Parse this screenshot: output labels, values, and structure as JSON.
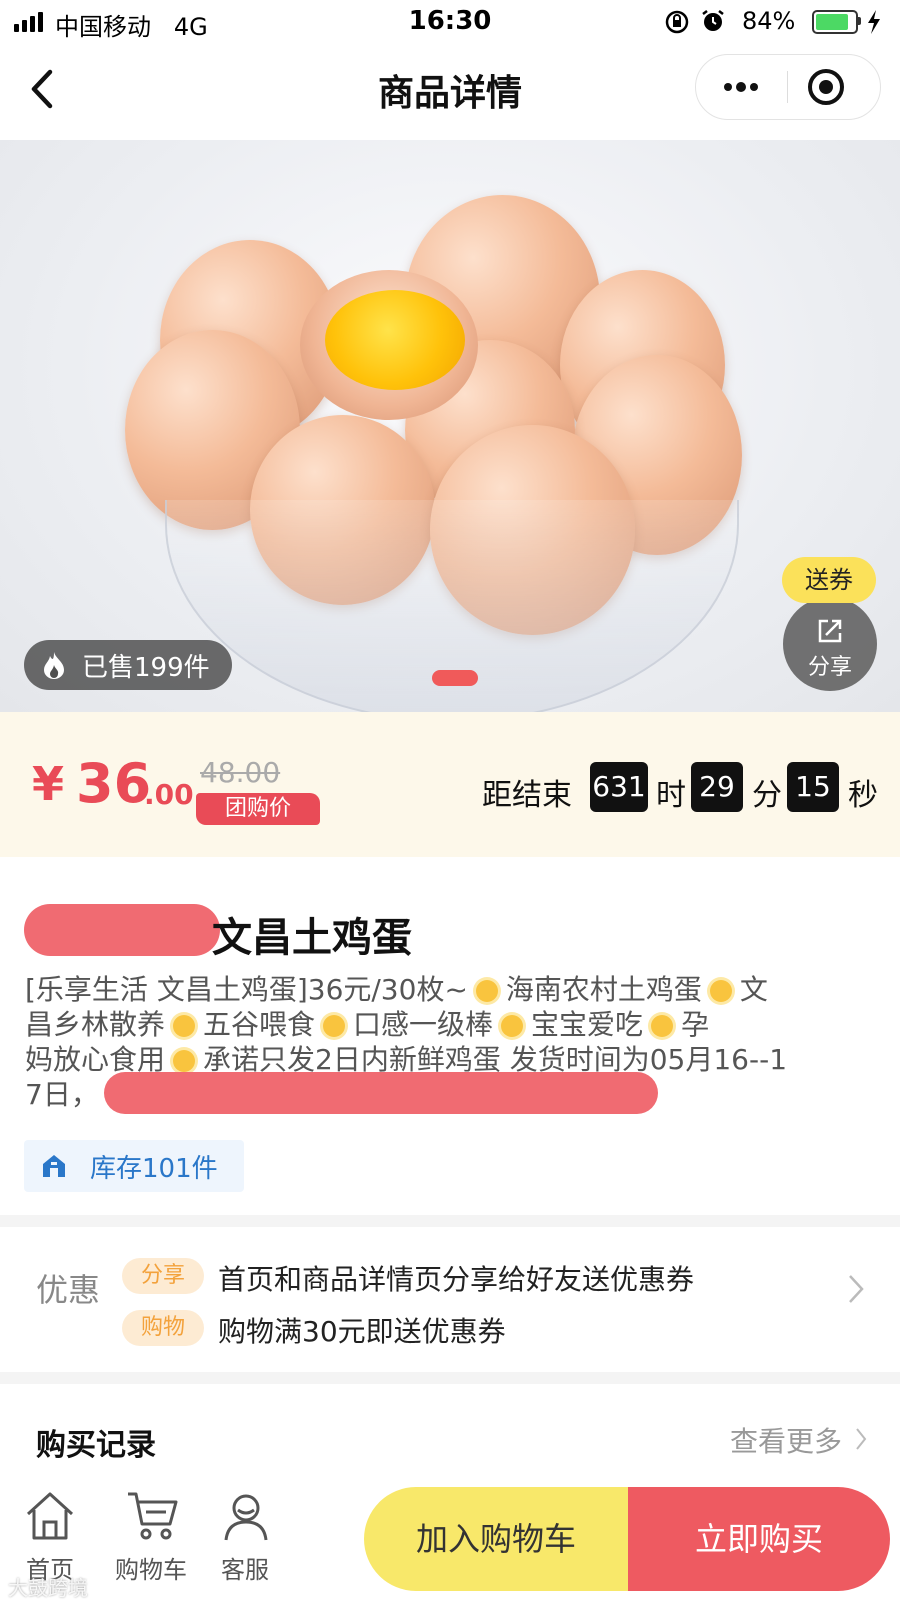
{
  "status_bar": {
    "carrier": "中国移动",
    "network": "4G",
    "time": "16:30",
    "battery_percent": "84%",
    "battery_level": 0.84
  },
  "nav": {
    "title": "商品详情"
  },
  "hero": {
    "sold_label": "已售199件",
    "coupon_tag": "送券",
    "share_label": "分享"
  },
  "price": {
    "currency": "¥",
    "integer": "36",
    "decimal": ".00",
    "original": "48.00",
    "group_label": "团购价",
    "countdown_label": "距结束",
    "hours": "631",
    "hours_unit": "时",
    "minutes": "29",
    "minutes_unit": "分",
    "seconds": "15",
    "seconds_unit": "秒"
  },
  "product": {
    "title_visible": "文昌土鸡蛋",
    "desc_line1_a": "[乐享生活 文昌土鸡蛋]36元/30枚~",
    "desc_line1_b": "海南农村土鸡蛋",
    "desc_line1_c": "文",
    "desc_line2_a": "昌乡林散养",
    "desc_line2_b": "五谷喂食",
    "desc_line2_c": "口感一级棒",
    "desc_line2_d": "宝宝爱吃",
    "desc_line2_e": "孕",
    "desc_line3_a": "妈放心食用",
    "desc_line3_b": "承诺只发2日内新鲜鸡蛋 发货时间为05月16--1",
    "desc_line4_a": "7日，",
    "stock": "库存101件"
  },
  "promotions": {
    "label": "优惠",
    "items": [
      {
        "tag": "分享",
        "text": "首页和商品详情页分享给好友送优惠券"
      },
      {
        "tag": "购物",
        "text": "购物满30元即送优惠券"
      }
    ]
  },
  "records": {
    "title": "购买记录",
    "more": "查看更多"
  },
  "bottom_bar": {
    "tabs": [
      {
        "label": "首页",
        "icon": "home-icon"
      },
      {
        "label": "购物车",
        "icon": "cart-icon"
      },
      {
        "label": "客服",
        "icon": "support-icon"
      }
    ],
    "add_to_cart": "加入购物车",
    "buy_now": "立即购买"
  },
  "watermark": "大鼓跨境",
  "colors": {
    "accent_red": "#e94b57",
    "button_yellow": "#f8e86a",
    "button_red": "#ee5a61",
    "stock_blue": "#2a77c9"
  }
}
